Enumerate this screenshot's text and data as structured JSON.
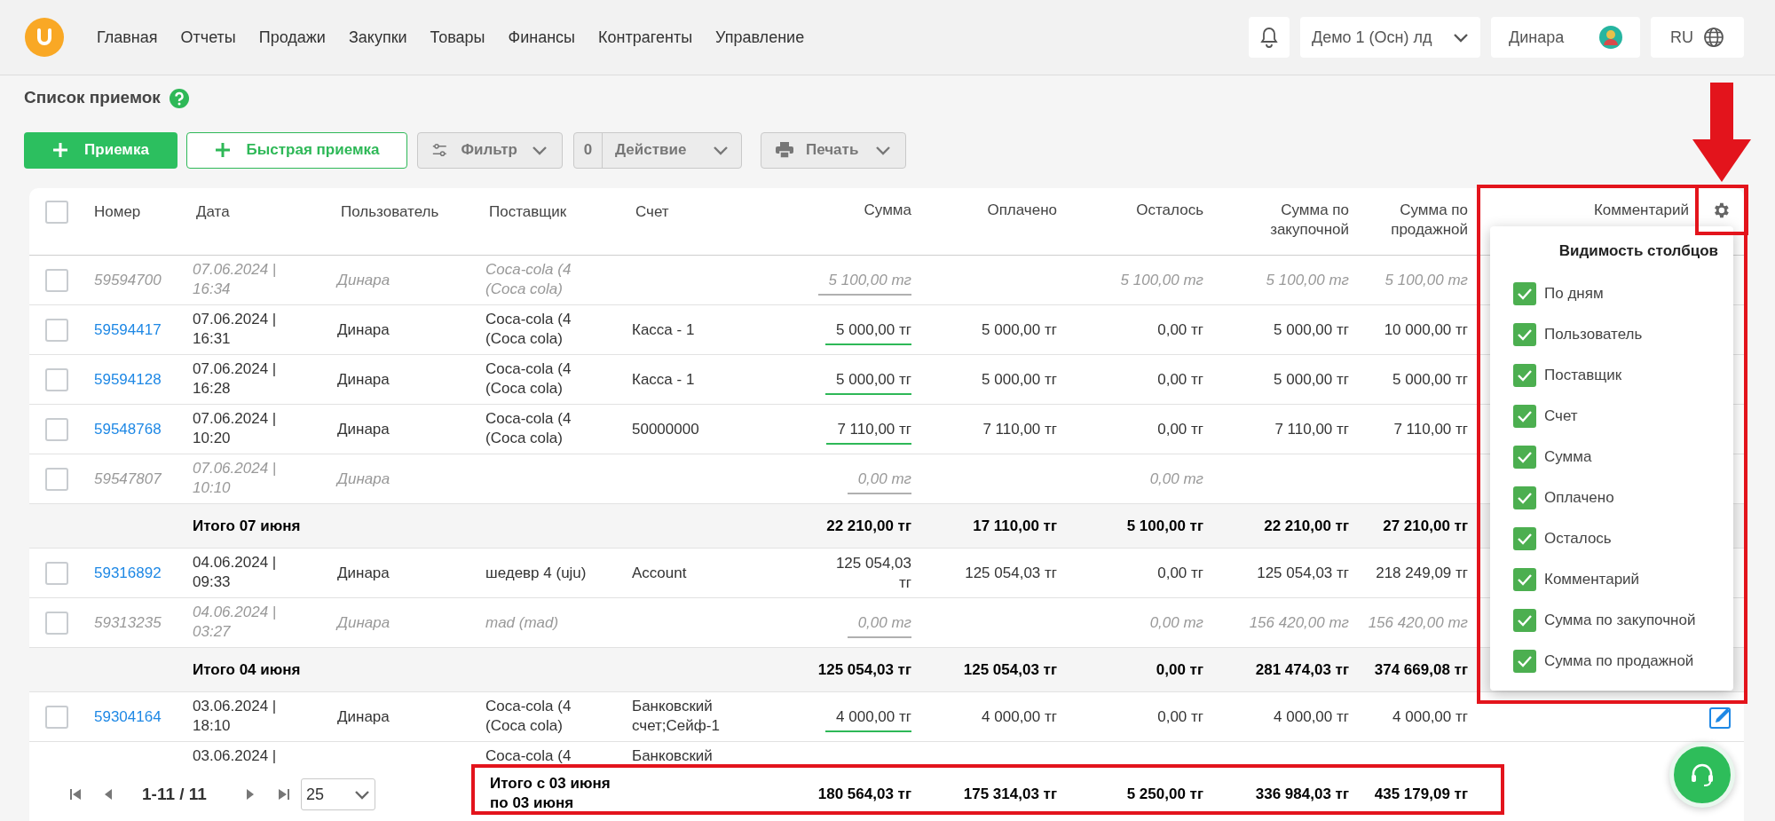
{
  "header": {
    "nav": [
      "Главная",
      "Отчеты",
      "Продажи",
      "Закупки",
      "Товары",
      "Финансы",
      "Контрагенты",
      "Управление"
    ],
    "company": "Демо 1 (Осн) лд",
    "user": "Динара",
    "language": "RU"
  },
  "page": {
    "title": "Список приемок"
  },
  "toolbar": {
    "add_button": "Приемка",
    "quick_add_button": "Быстрая приемка",
    "filter_button": "Фильтр",
    "action_count": "0",
    "action_button": "Действие",
    "print_button": "Печать"
  },
  "table": {
    "all_checked": false,
    "columns": [
      "Номер",
      "Дата",
      "Пользователь",
      "Поставщик",
      "Счет",
      "Сумма",
      "Оплачено",
      "Осталось",
      "Сумма по закупочной",
      "Сумма по продажной",
      "Комментарий"
    ],
    "rows": [
      {
        "kind": "row",
        "checked": false,
        "muted": true,
        "number": "59594700",
        "date": "07.06.2024 | 16:34",
        "user": "Динара",
        "supplier": "Coca-cola (4 (Coca cola)",
        "sum": "5 100,00 тг",
        "color": "#b0b0b0",
        "remaining": "5 100,00 тг",
        "purchase": "5 100,00 тг",
        "sale": "5 100,00 тг"
      },
      {
        "kind": "row",
        "checked": false,
        "muted": false,
        "number": "59594417",
        "date": "07.06.2024 | 16:31",
        "user": "Динара",
        "supplier": "Coca-cola (4 (Coca cola)",
        "account": "Касса - 1",
        "sum": "5 000,00 тг",
        "color": "#2eb857",
        "paid": "5 000,00 тг",
        "remaining": "0,00 тг",
        "purchase": "5 000,00 тг",
        "sale": "10 000,00 тг"
      },
      {
        "kind": "row",
        "checked": false,
        "muted": false,
        "number": "59594128",
        "date": "07.06.2024 | 16:28",
        "user": "Динара",
        "supplier": "Coca-cola (4 (Coca cola)",
        "account": "Касса - 1",
        "sum": "5 000,00 тг",
        "color": "#2eb857",
        "paid": "5 000,00 тг",
        "remaining": "0,00 тг",
        "purchase": "5 000,00 тг",
        "sale": "5 000,00 тг"
      },
      {
        "kind": "row",
        "checked": false,
        "muted": false,
        "number": "59548768",
        "date": "07.06.2024 | 10:20",
        "user": "Динара",
        "supplier": "Coca-cola (4 (Coca cola)",
        "account": "50000000",
        "sum": "7 110,00 тг",
        "color": "#2eb857",
        "paid": "7 110,00 тг",
        "remaining": "0,00 тг",
        "purchase": "7 110,00 тг",
        "sale": "7 110,00 тг"
      },
      {
        "kind": "row",
        "checked": false,
        "muted": true,
        "number": "59547807",
        "date": "07.06.2024 | 10:10",
        "user": "Динара",
        "sum": "0,00 тг",
        "color": "#b0b0b0",
        "remaining": "0,00 тг"
      },
      {
        "kind": "subtotal",
        "label": "Итого 07 июня",
        "sum": "22 210,00 тг",
        "paid": "17 110,00 тг",
        "remaining": "5 100,00 тг",
        "purchase": "22 210,00 тг",
        "sale": "27 210,00 тг"
      },
      {
        "kind": "row",
        "checked": false,
        "muted": false,
        "number": "59316892",
        "date": "04.06.2024 | 09:33",
        "user": "Динара",
        "supplier": "шедевр 4 (uju)",
        "account": "Account",
        "sum": "125 054,03 тг",
        "paid": "125 054,03 тг",
        "remaining": "0,00 тг",
        "purchase": "125 054,03 тг",
        "sale": "218 249,09 тг"
      },
      {
        "kind": "row",
        "checked": false,
        "muted": true,
        "number": "59313235",
        "date": "04.06.2024 | 03:27",
        "user": "Динара",
        "supplier": "mad (mad)",
        "sum": "0,00 тг",
        "color": "#b0b0b0",
        "remaining": "0,00 тг",
        "purchase": "156 420,00 тг",
        "sale": "156 420,00 тг"
      },
      {
        "kind": "subtotal",
        "label": "Итого 04 июня",
        "sum": "125 054,03 тг",
        "paid": "125 054,03 тг",
        "remaining": "0,00 тг",
        "purchase": "281 474,03 тг",
        "sale": "374 669,08 тг"
      },
      {
        "kind": "row",
        "checked": false,
        "muted": false,
        "number": "59304164",
        "date": "03.06.2024 | 18:10",
        "user": "Динара",
        "supplier": "Coca-cola (4 (Coca cola)",
        "account": "Банковский счет;Сейф-1",
        "sum": "4 000,00 тг",
        "color": "#2eb857",
        "paid": "4 000,00 тг",
        "remaining": "0,00 тг",
        "purchase": "4 000,00 тг",
        "sale": "4 000,00 тг",
        "editable": true
      },
      {
        "kind": "row",
        "muted": false,
        "date": "03.06.2024 |",
        "supplier": "Coca-cola (4",
        "account": "Банковский"
      }
    ]
  },
  "footer": {
    "pagination": "1-11 / 11",
    "page_size": "25",
    "total_label": "Итого с 03 июня по 03 июня",
    "totals": [
      "180 564,03 тг",
      "175 314,03 тг",
      "5 250,00 тг",
      "336 984,03 тг",
      "435 179,09 тг"
    ]
  },
  "column_menu": {
    "title": "Видимость столбцов",
    "items": [
      {
        "label": "По дням",
        "checked": true
      },
      {
        "label": "Пользователь",
        "checked": true
      },
      {
        "label": "Поставщик",
        "checked": true
      },
      {
        "label": "Счет",
        "checked": true
      },
      {
        "label": "Сумма",
        "checked": true
      },
      {
        "label": "Оплачено",
        "checked": true
      },
      {
        "label": "Осталось",
        "checked": true
      },
      {
        "label": "Комментарий",
        "checked": true
      },
      {
        "label": "Сумма по закупочной",
        "checked": true
      },
      {
        "label": "Сумма по продажной",
        "checked": true
      }
    ]
  }
}
